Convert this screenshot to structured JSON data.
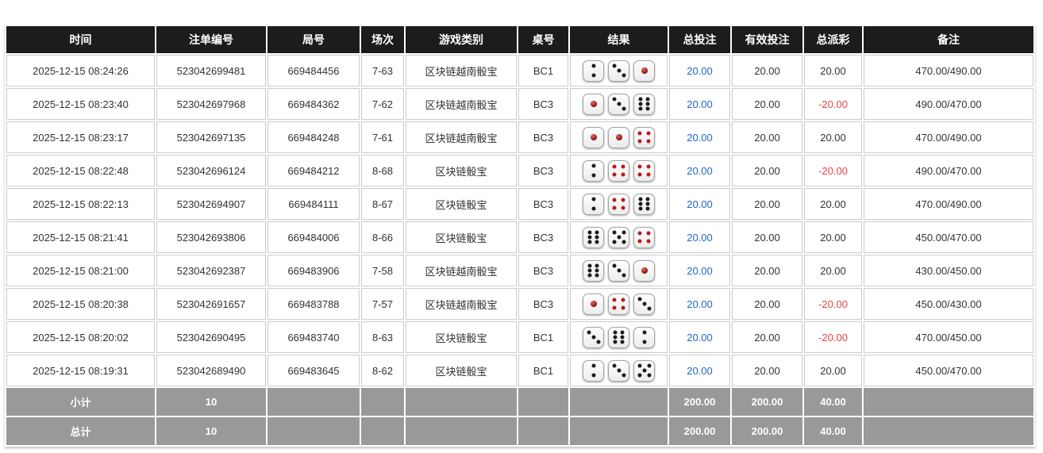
{
  "colors": {
    "header_bg": "#1c1c1c",
    "header_text": "#ffffff",
    "footer_bg": "#999999",
    "cell_border": "#cccccc",
    "body_text": "#333333",
    "total_bet_blue": "#2166d1",
    "negative_red": "#e64444",
    "die_dot_black": "#1c1c1c",
    "die_dot_red": "#bb1a1a"
  },
  "table": {
    "columns": [
      {
        "key": "time",
        "label": "时间"
      },
      {
        "key": "bet_id",
        "label": "注单编号"
      },
      {
        "key": "round_id",
        "label": "局号"
      },
      {
        "key": "session",
        "label": "场次"
      },
      {
        "key": "game_type",
        "label": "游戏类别"
      },
      {
        "key": "table_no",
        "label": "桌号"
      },
      {
        "key": "result",
        "label": "结果"
      },
      {
        "key": "total_bet",
        "label": "总投注"
      },
      {
        "key": "valid_bet",
        "label": "有效投注"
      },
      {
        "key": "total_payout",
        "label": "总派彩"
      },
      {
        "key": "remark",
        "label": "备注"
      }
    ],
    "rows": [
      {
        "time": "2025-12-15 08:24:26",
        "bet_id": "523042699481",
        "round_id": "669484456",
        "session": "7-63",
        "game_type": "区块链越南骰宝",
        "table_no": "BC1",
        "dice": [
          2,
          3,
          1
        ],
        "total_bet": "20.00",
        "valid_bet": "20.00",
        "total_payout": "20.00",
        "remark": "470.00/490.00"
      },
      {
        "time": "2025-12-15 08:23:40",
        "bet_id": "523042697968",
        "round_id": "669484362",
        "session": "7-62",
        "game_type": "区块链越南骰宝",
        "table_no": "BC3",
        "dice": [
          1,
          3,
          6
        ],
        "total_bet": "20.00",
        "valid_bet": "20.00",
        "total_payout": "-20.00",
        "remark": "490.00/470.00"
      },
      {
        "time": "2025-12-15 08:23:17",
        "bet_id": "523042697135",
        "round_id": "669484248",
        "session": "7-61",
        "game_type": "区块链越南骰宝",
        "table_no": "BC3",
        "dice": [
          1,
          1,
          4
        ],
        "total_bet": "20.00",
        "valid_bet": "20.00",
        "total_payout": "20.00",
        "remark": "470.00/490.00"
      },
      {
        "time": "2025-12-15 08:22:48",
        "bet_id": "523042696124",
        "round_id": "669484212",
        "session": "8-68",
        "game_type": "区块链骰宝",
        "table_no": "BC3",
        "dice": [
          2,
          4,
          4
        ],
        "total_bet": "20.00",
        "valid_bet": "20.00",
        "total_payout": "-20.00",
        "remark": "490.00/470.00"
      },
      {
        "time": "2025-12-15 08:22:13",
        "bet_id": "523042694907",
        "round_id": "669484111",
        "session": "8-67",
        "game_type": "区块链骰宝",
        "table_no": "BC3",
        "dice": [
          2,
          4,
          6
        ],
        "total_bet": "20.00",
        "valid_bet": "20.00",
        "total_payout": "20.00",
        "remark": "470.00/490.00"
      },
      {
        "time": "2025-12-15 08:21:41",
        "bet_id": "523042693806",
        "round_id": "669484006",
        "session": "8-66",
        "game_type": "区块链骰宝",
        "table_no": "BC3",
        "dice": [
          6,
          5,
          4
        ],
        "total_bet": "20.00",
        "valid_bet": "20.00",
        "total_payout": "20.00",
        "remark": "450.00/470.00"
      },
      {
        "time": "2025-12-15 08:21:00",
        "bet_id": "523042692387",
        "round_id": "669483906",
        "session": "7-58",
        "game_type": "区块链越南骰宝",
        "table_no": "BC3",
        "dice": [
          6,
          3,
          1
        ],
        "total_bet": "20.00",
        "valid_bet": "20.00",
        "total_payout": "20.00",
        "remark": "430.00/450.00"
      },
      {
        "time": "2025-12-15 08:20:38",
        "bet_id": "523042691657",
        "round_id": "669483788",
        "session": "7-57",
        "game_type": "区块链越南骰宝",
        "table_no": "BC3",
        "dice": [
          1,
          4,
          3
        ],
        "total_bet": "20.00",
        "valid_bet": "20.00",
        "total_payout": "-20.00",
        "remark": "450.00/430.00"
      },
      {
        "time": "2025-12-15 08:20:02",
        "bet_id": "523042690495",
        "round_id": "669483740",
        "session": "8-63",
        "game_type": "区块链骰宝",
        "table_no": "BC1",
        "dice": [
          3,
          6,
          2
        ],
        "total_bet": "20.00",
        "valid_bet": "20.00",
        "total_payout": "-20.00",
        "remark": "470.00/450.00"
      },
      {
        "time": "2025-12-15 08:19:31",
        "bet_id": "523042689490",
        "round_id": "669483645",
        "session": "8-62",
        "game_type": "区块链骰宝",
        "table_no": "BC1",
        "dice": [
          2,
          3,
          5
        ],
        "total_bet": "20.00",
        "valid_bet": "20.00",
        "total_payout": "20.00",
        "remark": "450.00/470.00"
      }
    ],
    "footer": [
      {
        "key": "subtotal",
        "label": "小计",
        "count": "10",
        "total_bet": "200.00",
        "valid_bet": "200.00",
        "total_payout": "40.00"
      },
      {
        "key": "total",
        "label": "总计",
        "count": "10",
        "total_bet": "200.00",
        "valid_bet": "200.00",
        "total_payout": "40.00"
      }
    ]
  }
}
